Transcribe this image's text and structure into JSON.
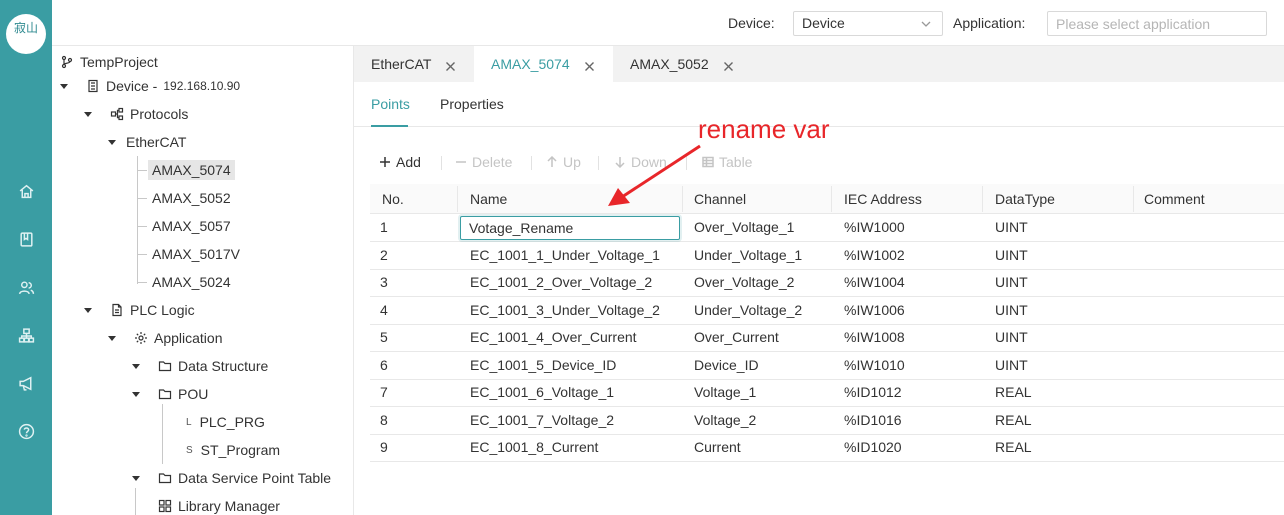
{
  "logo": {
    "text": "寂山"
  },
  "rail": {
    "icons": [
      "home-icon",
      "book-icon",
      "users-icon",
      "network-icon",
      "megaphone-icon",
      "help-icon"
    ]
  },
  "topbar": {
    "device_label": "Device:",
    "device_value": "Device",
    "application_label": "Application:",
    "application_placeholder": "Please select application"
  },
  "tree": {
    "project": "TempProject",
    "device": {
      "label": "Device -",
      "ip": "192.168.10.90"
    },
    "protocols": "Protocols",
    "ethercat": "EtherCAT",
    "slaves": [
      "AMAX_5074",
      "AMAX_5052",
      "AMAX_5057",
      "AMAX_5017V",
      "AMAX_5024"
    ],
    "plc_logic": "PLC Logic",
    "application": "Application",
    "data_structure": "Data Structure",
    "pou": "POU",
    "pou_items": [
      {
        "prefix": "L",
        "label": "PLC_PRG"
      },
      {
        "prefix": "S",
        "label": "ST_Program"
      }
    ],
    "data_service": "Data Service Point Table",
    "library": "Library Manager"
  },
  "tabs": [
    "EtherCAT",
    "AMAX_5074",
    "AMAX_5052"
  ],
  "active_tab": "AMAX_5074",
  "subtabs": [
    "Points",
    "Properties"
  ],
  "toolbar": {
    "add": "Add",
    "delete": "Delete",
    "up": "Up",
    "down": "Down",
    "table": "Table"
  },
  "table": {
    "columns": [
      "No.",
      "Name",
      "Channel",
      "IEC Address",
      "DataType",
      "Comment"
    ],
    "rows": [
      {
        "no": "1",
        "name": "Votage_Rename",
        "channel": "Over_Voltage_1",
        "iec": "%IW1000",
        "type": "UINT",
        "comment": ""
      },
      {
        "no": "2",
        "name": "EC_1001_1_Under_Voltage_1",
        "channel": "Under_Voltage_1",
        "iec": "%IW1002",
        "type": "UINT",
        "comment": ""
      },
      {
        "no": "3",
        "name": "EC_1001_2_Over_Voltage_2",
        "channel": "Over_Voltage_2",
        "iec": "%IW1004",
        "type": "UINT",
        "comment": ""
      },
      {
        "no": "4",
        "name": "EC_1001_3_Under_Voltage_2",
        "channel": "Under_Voltage_2",
        "iec": "%IW1006",
        "type": "UINT",
        "comment": ""
      },
      {
        "no": "5",
        "name": "EC_1001_4_Over_Current",
        "channel": "Over_Current",
        "iec": "%IW1008",
        "type": "UINT",
        "comment": ""
      },
      {
        "no": "6",
        "name": "EC_1001_5_Device_ID",
        "channel": "Device_ID",
        "iec": "%IW1010",
        "type": "UINT",
        "comment": ""
      },
      {
        "no": "7",
        "name": "EC_1001_6_Voltage_1",
        "channel": "Voltage_1",
        "iec": "%ID1012",
        "type": "REAL",
        "comment": ""
      },
      {
        "no": "8",
        "name": "EC_1001_7_Voltage_2",
        "channel": "Voltage_2",
        "iec": "%ID1016",
        "type": "REAL",
        "comment": ""
      },
      {
        "no": "9",
        "name": "EC_1001_8_Current",
        "channel": "Current",
        "iec": "%ID1020",
        "type": "REAL",
        "comment": ""
      }
    ]
  },
  "annotation": {
    "text": "rename var",
    "color": "#e8262a"
  },
  "colors": {
    "accent": "#3a9da3",
    "rail": "#3a9da3",
    "annotation": "#e8262a"
  }
}
